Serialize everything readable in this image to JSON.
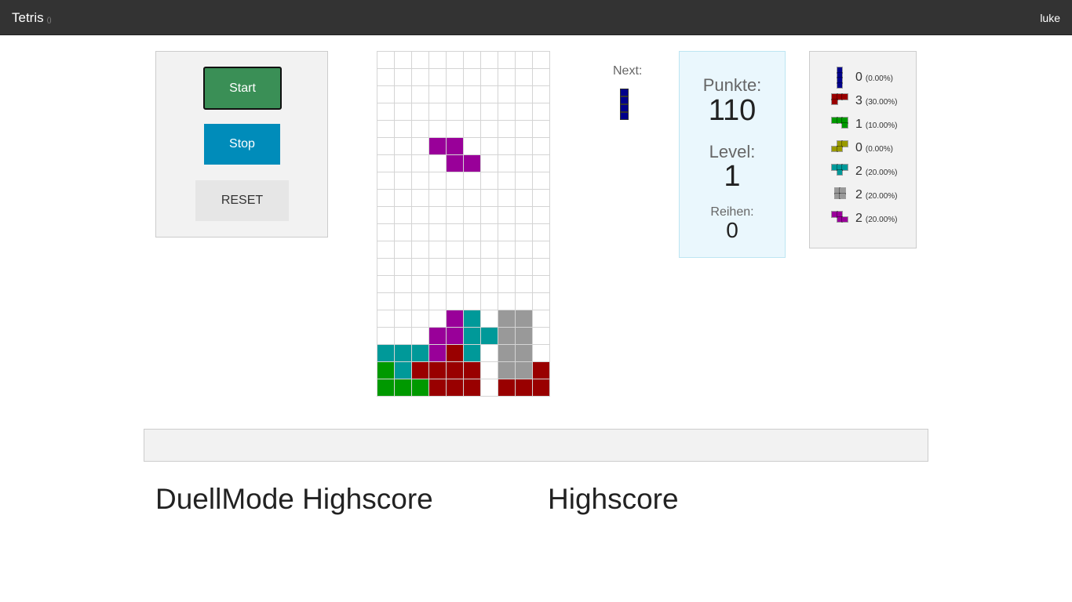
{
  "nav": {
    "title": "Tetris",
    "badge": "()",
    "user": "luke"
  },
  "controls": {
    "start_label": "Start",
    "stop_label": "Stop",
    "reset_label": "RESET"
  },
  "colors": {
    "T": "#990099",
    "S": "#990099",
    "L": "#990000",
    "Z": "#009900",
    "C": "#009999",
    "G": "#999999",
    "R": "#990000",
    "P": "#990099",
    "I": "#00008b",
    "Y": "#999900"
  },
  "board": {
    "cols": 10,
    "rows": 20,
    "grid": [
      "..........",
      "..........",
      "..........",
      "..........",
      "..........",
      "...PP.....",
      "....PP....",
      "..........",
      "..........",
      "..........",
      "..........",
      "..........",
      "..........",
      "..........",
      "..........",
      "....PC.GG.",
      "...PPCCGG.",
      "CCCPRC.GG.",
      "ZCRRRR.GGR",
      "ZZZRRR.RRR"
    ]
  },
  "next": {
    "label": "Next:",
    "piece": "I",
    "icon": "i-piece-icon"
  },
  "score": {
    "points_label": "Punkte:",
    "points": "110",
    "level_label": "Level:",
    "level": "1",
    "rows_label": "Reihen:",
    "rows": "0"
  },
  "stats": [
    {
      "piece": "I",
      "icon": "i-piece-icon",
      "count": "0",
      "pct": "(0.00%)"
    },
    {
      "piece": "L",
      "icon": "l-piece-icon",
      "count": "3",
      "pct": "(30.00%)"
    },
    {
      "piece": "J",
      "icon": "j-piece-icon",
      "count": "1",
      "pct": "(10.00%)"
    },
    {
      "piece": "S",
      "icon": "s-piece-icon",
      "count": "0",
      "pct": "(0.00%)"
    },
    {
      "piece": "T",
      "icon": "t-piece-icon",
      "count": "2",
      "pct": "(20.00%)"
    },
    {
      "piece": "O",
      "icon": "o-piece-icon",
      "count": "2",
      "pct": "(20.00%)"
    },
    {
      "piece": "Z",
      "icon": "z-piece-icon",
      "count": "2",
      "pct": "(20.00%)"
    }
  ],
  "headings": {
    "duel": "DuellMode Highscore",
    "high": "Highscore"
  }
}
